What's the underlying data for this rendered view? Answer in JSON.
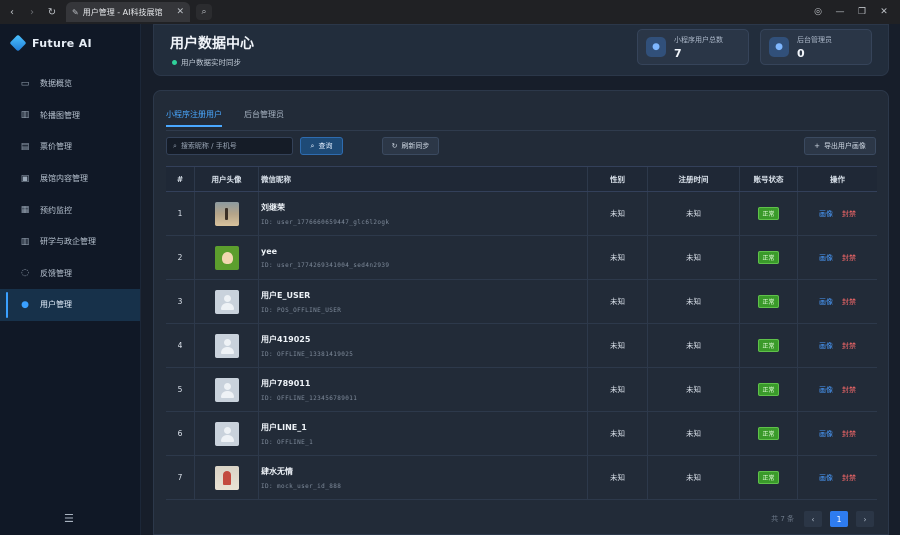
{
  "browser": {
    "tab_title": "用户管理 - AI科技展馆"
  },
  "sidebar": {
    "brand": "Future AI",
    "items": [
      {
        "label": "数据概览",
        "icon": "monitor-icon"
      },
      {
        "label": "轮播图管理",
        "icon": "building-icon"
      },
      {
        "label": "票价管理",
        "icon": "clipboard-icon"
      },
      {
        "label": "展馆内容管理",
        "icon": "image-icon"
      },
      {
        "label": "预约监控",
        "icon": "calendar-icon"
      },
      {
        "label": "研学与政企管理",
        "icon": "building-icon"
      },
      {
        "label": "反馈管理",
        "icon": "chat-icon"
      },
      {
        "label": "用户管理",
        "icon": "user-icon",
        "active": true
      }
    ]
  },
  "header": {
    "title": "用户数据中心",
    "sync_text": "用户数据实时同步",
    "stats": [
      {
        "label": "小程序用户总数",
        "value": "7"
      },
      {
        "label": "后台管理员",
        "value": "0"
      }
    ]
  },
  "tabs": [
    "小程序注册用户",
    "后台管理员"
  ],
  "toolbar": {
    "search_placeholder": "搜索昵称 / 手机号",
    "query_label": "查询",
    "refresh_label": "刷新同步",
    "export_label": "导出用户画像"
  },
  "table": {
    "columns": [
      "#",
      "用户头像",
      "微信昵称",
      "性别",
      "注册时间",
      "账号状态",
      "操作"
    ],
    "rows": [
      {
        "idx": "1",
        "name": "刘继荣",
        "id": "ID: user_1776660659447_glc6l2ogk",
        "sex": "未知",
        "time": "未知",
        "status": "正常",
        "avatar": "beach"
      },
      {
        "idx": "2",
        "name": "yee",
        "id": "ID: user_1774269341004_sed4n2939",
        "sex": "未知",
        "time": "未知",
        "status": "正常",
        "avatar": "green"
      },
      {
        "idx": "3",
        "name": "用户E_USER",
        "id": "ID: POS_OFFLINE_USER",
        "sex": "未知",
        "time": "未知",
        "status": "正常",
        "avatar": "default"
      },
      {
        "idx": "4",
        "name": "用户419025",
        "id": "ID: OFFLINE_13381419025",
        "sex": "未知",
        "time": "未知",
        "status": "正常",
        "avatar": "default"
      },
      {
        "idx": "5",
        "name": "用户789011",
        "id": "ID: OFFLINE_123456789011",
        "sex": "未知",
        "time": "未知",
        "status": "正常",
        "avatar": "default"
      },
      {
        "idx": "6",
        "name": "用户LINE_1",
        "id": "ID: OFFLINE_1",
        "sex": "未知",
        "time": "未知",
        "status": "正常",
        "avatar": "default"
      },
      {
        "idx": "7",
        "name": "肆水无情",
        "id": "ID: mock_user_id_888",
        "sex": "未知",
        "time": "未知",
        "status": "正常",
        "avatar": "person"
      }
    ],
    "ops": {
      "profile": "画像",
      "ban": "封禁"
    }
  },
  "pager": {
    "total": "共 7 条",
    "current": "1"
  },
  "colors": {
    "accent": "#4aa8ff",
    "status_ok": "#3a9a2a",
    "danger": "#ff6b6b"
  }
}
